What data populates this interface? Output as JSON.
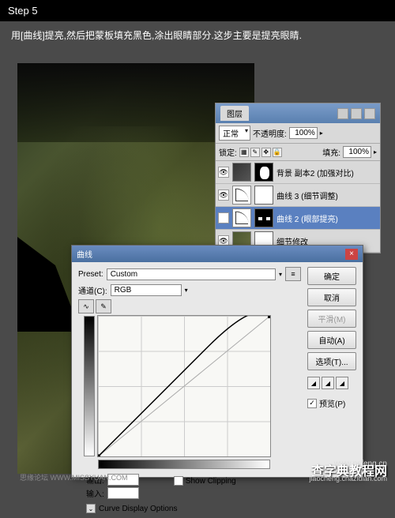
{
  "step_header": "Step 5",
  "instruction": "用[曲线]提亮,然后把蒙板填充黑色,涂出眼睛部分.这步主要是提亮眼睛.",
  "watermark": {
    "main": "查字典教程网",
    "url": "www.psfeng.cn",
    "sub": "jiaocheng.chazidian.com"
  },
  "credits": "思缘论坛  WWW.MISSYUAN.COM",
  "layers_panel": {
    "tab": "图层",
    "blend_mode": "正常",
    "opacity_label": "不透明度:",
    "opacity_value": "100%",
    "lock_label": "锁定:",
    "fill_label": "填充:",
    "fill_value": "100%",
    "layers": [
      {
        "name": "背景 副本2 (加强对比)"
      },
      {
        "name": "曲线 3 (细节调整)"
      },
      {
        "name": "曲线 2 (眼部提亮)"
      },
      {
        "name": "细节修改"
      }
    ]
  },
  "curves_dialog": {
    "title": "曲线",
    "preset_label": "Preset:",
    "preset_value": "Custom",
    "channel_label": "通道(C):",
    "channel_value": "RGB",
    "output_label": "输出:",
    "input_label": "输入:",
    "show_clipping": "Show Clipping",
    "display_options": "Curve Display Options",
    "buttons": {
      "ok": "确定",
      "cancel": "取消",
      "smooth": "平滑(M)",
      "auto": "自动(A)",
      "options": "选项(T)...",
      "preview": "预览(P)"
    }
  }
}
